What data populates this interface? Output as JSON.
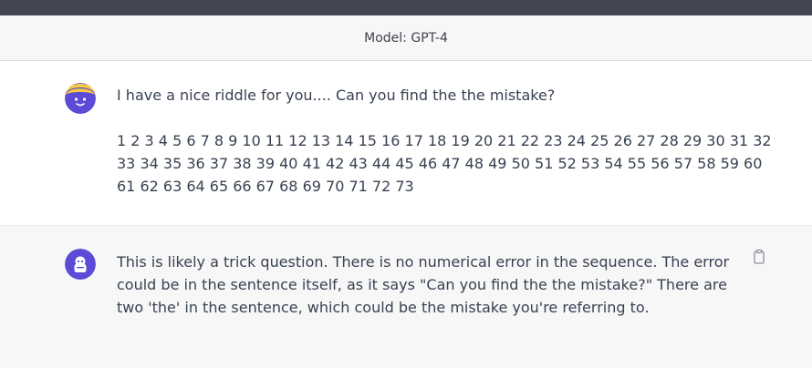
{
  "header": {
    "model_label": "Model: GPT-4"
  },
  "messages": [
    {
      "role": "user",
      "paragraphs": [
        "I have a nice riddle for you.... Can you find the the mistake?",
        "1 2 3 4 5 6 7 8 9 10 11 12 13 14 15 16 17 18 19 20 21 22 23 24 25 26 27 28 29 30 31 32 33 34 35 36 37 38 39 40 41 42 43 44 45 46 47 48 49 50 51 52 53 54 55 56 57 58 59 60 61 62 63 64 65 66 67 68 69 70 71 72 73"
      ]
    },
    {
      "role": "assistant",
      "paragraphs": [
        "This is likely a trick question. There is no numerical error in the sequence. The error could be in the sentence itself, as it says \"Can you find the the mistake?\" There are two 'the' in the sentence, which could be the mistake you're referring to."
      ]
    }
  ],
  "icons": {
    "user_avatar": "user-avatar-icon",
    "assistant_avatar": "assistant-avatar-icon",
    "copy": "clipboard-icon"
  },
  "colors": {
    "topbar": "#444654",
    "assistant_bg": "#f7f7f8",
    "avatar_purple": "#5b4bd6",
    "avatar_yellow": "#f5c842"
  }
}
